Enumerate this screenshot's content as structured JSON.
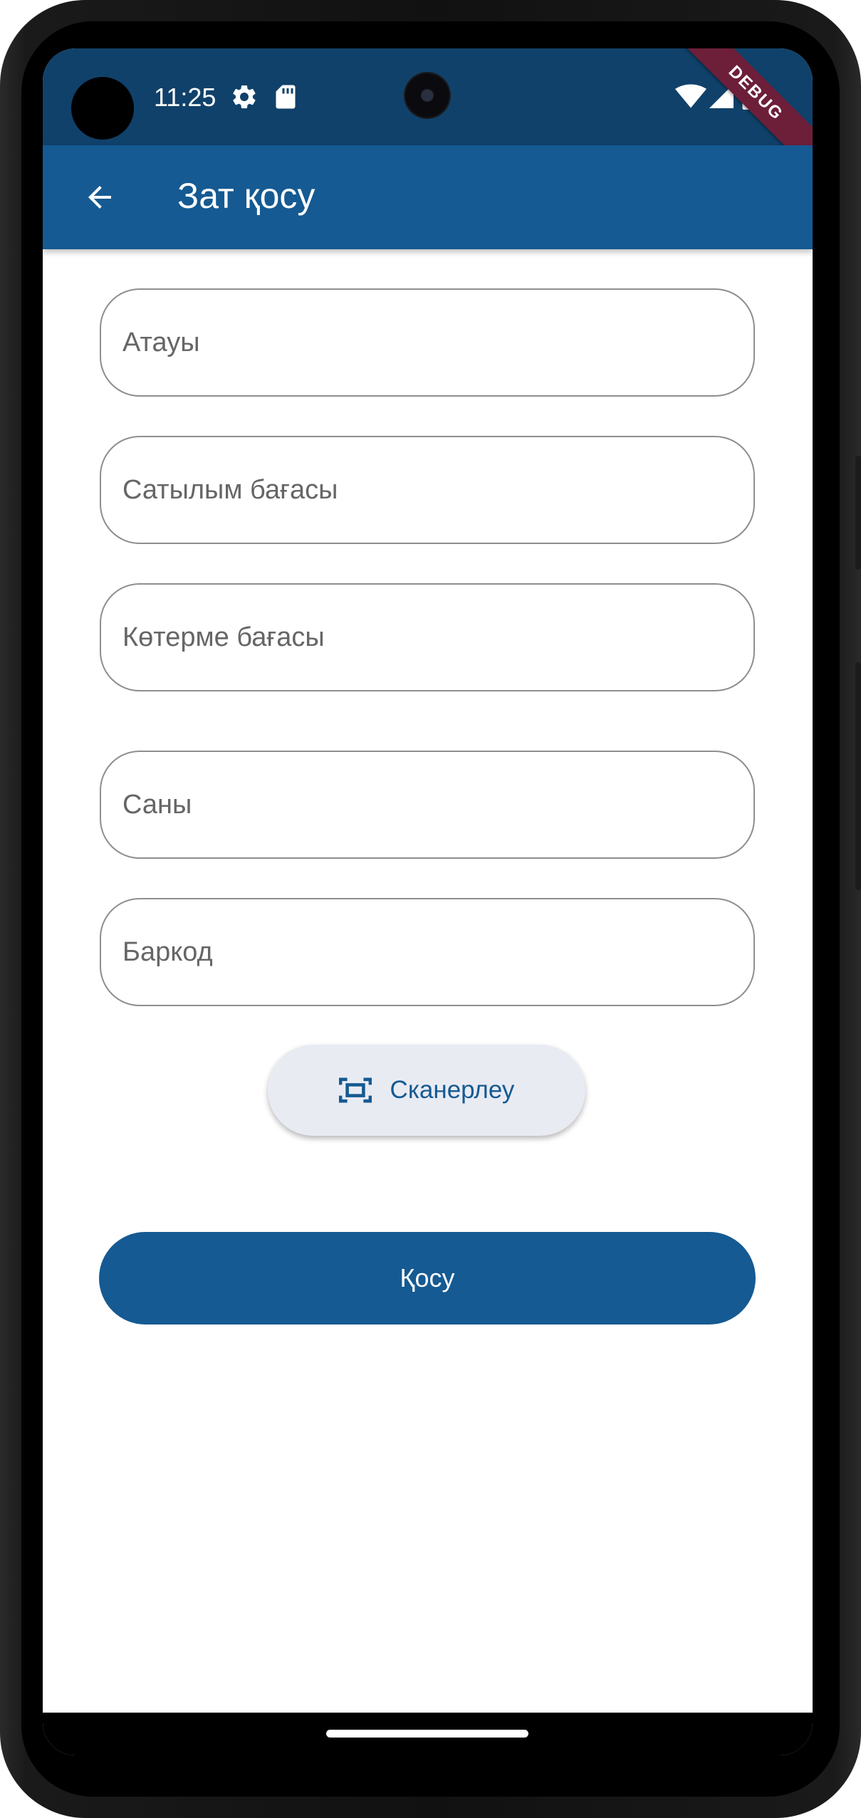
{
  "status_bar": {
    "time": "11:25",
    "icons": [
      "settings-gear-icon",
      "sd-card-icon",
      "wifi-icon",
      "cell-signal-icon",
      "battery-icon"
    ],
    "debug_label": "DEBUG"
  },
  "app_bar": {
    "title": "Зат қосу",
    "back_icon": "arrow-back-icon"
  },
  "form": {
    "name_placeholder": "Атауы",
    "sale_price_placeholder": "Сатылым бағасы",
    "wholesale_price_placeholder": "Көтерме бағасы",
    "quantity_placeholder": "Саны",
    "barcode_placeholder": "Баркод",
    "scan_label": "Сканерлеу",
    "scan_icon": "barcode-scan-icon",
    "submit_label": "Қосу"
  },
  "colors": {
    "primary": "#155a92",
    "status_bar": "#10416a",
    "debug_ribbon": "#6d1f3a",
    "scan_button_bg": "#e9ebf3",
    "field_border": "#8e8e8e"
  }
}
